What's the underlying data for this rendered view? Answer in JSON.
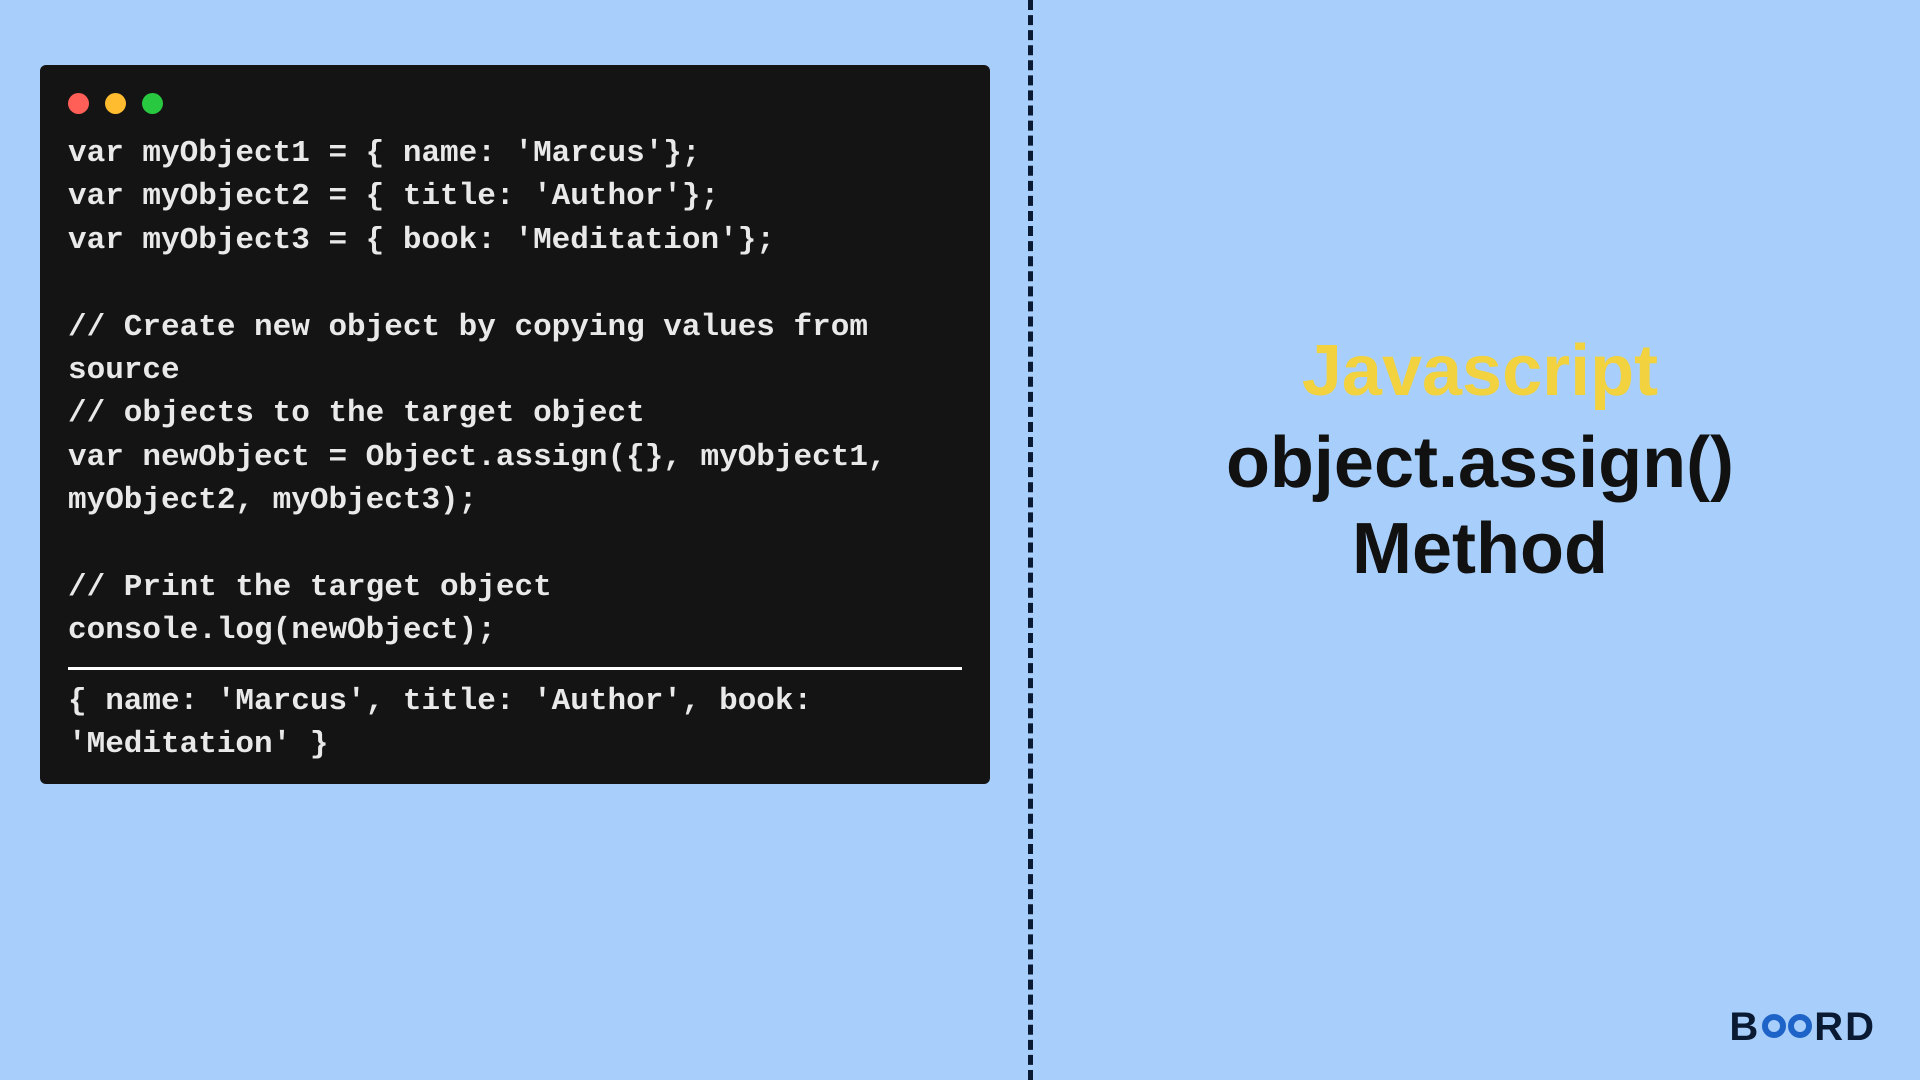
{
  "title": {
    "line1": "Javascript",
    "line2": "object.assign()",
    "line3": "Method"
  },
  "code": "var myObject1 = { name: 'Marcus'};\nvar myObject2 = { title: 'Author'};\nvar myObject3 = { book: 'Meditation'};\n\n// Create new object by copying values from source\n// objects to the target object\nvar newObject = Object.assign({}, myObject1, myObject2, myObject3);\n\n// Print the target object\nconsole.log(newObject);",
  "output": "{ name: 'Marcus', title: 'Author', book: 'Meditation' }",
  "logo": {
    "prefix": "B",
    "suffix": "RD"
  }
}
